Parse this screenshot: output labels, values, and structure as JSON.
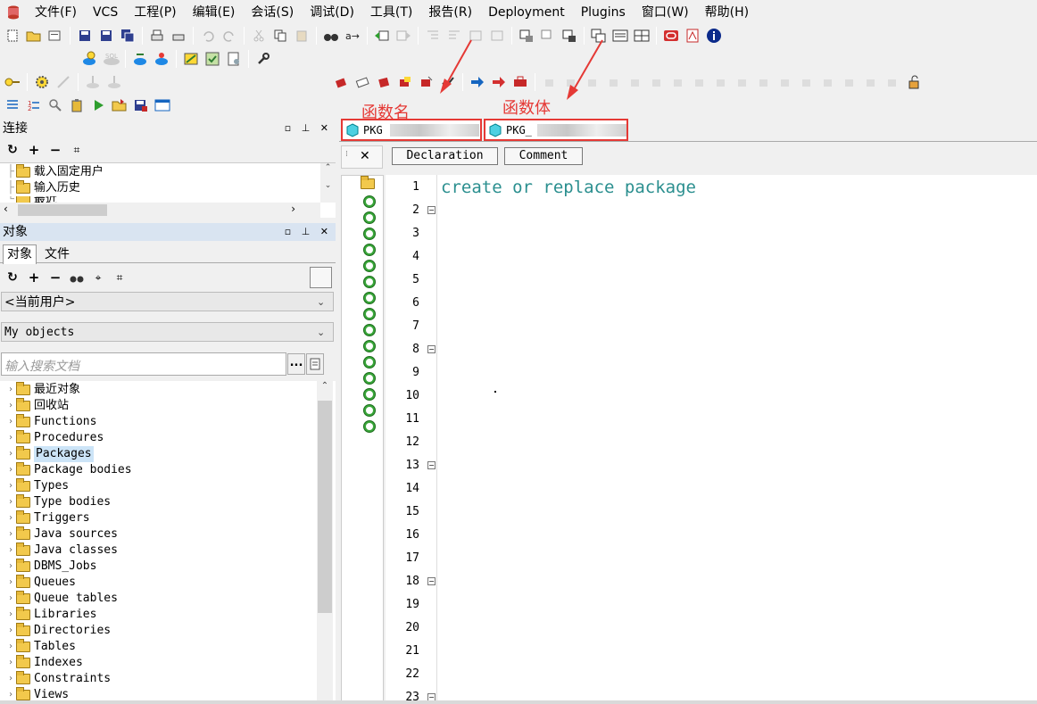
{
  "menu": [
    "文件(F)",
    "VCS",
    "工程(P)",
    "编辑(E)",
    "会话(S)",
    "调试(D)",
    "工具(T)",
    "报告(R)",
    "Deployment",
    "Plugins",
    "窗口(W)",
    "帮助(H)"
  ],
  "connection_panel": {
    "title": "连接",
    "tree": [
      "载入固定用户",
      "输入历史",
      "最近"
    ]
  },
  "objects_panel": {
    "title": "对象",
    "tabs": [
      "对象",
      "文件"
    ],
    "user_select": "<当前用户>",
    "filter_select": "My objects",
    "search_placeholder": "输入搜索文档",
    "more_button": "...",
    "tree": [
      "最近对象",
      "回收站",
      "Functions",
      "Procedures",
      "Packages",
      "Package bodies",
      "Types",
      "Type bodies",
      "Triggers",
      "Java sources",
      "Java classes",
      "DBMS_Jobs",
      "Queues",
      "Queue tables",
      "Libraries",
      "Directories",
      "Tables",
      "Indexes",
      "Constraints",
      "Views"
    ],
    "selected": "Packages"
  },
  "annotations": {
    "left": "函数名",
    "right": "函数体",
    "color": "#e53935"
  },
  "editor_tabs": [
    "PKG",
    "PKG_"
  ],
  "editor": {
    "close_glyph": "✕",
    "buttons": [
      "Declaration",
      "Comment"
    ],
    "code_line": "create or replace package",
    "code_color": "#2b8f8f",
    "line_numbers": [
      "1",
      "2",
      "3",
      "4",
      "5",
      "6",
      "7",
      "8",
      "9",
      "10",
      "11",
      "12",
      "13",
      "14",
      "15",
      "16",
      "17",
      "18",
      "19",
      "20",
      "21",
      "22",
      "23"
    ]
  }
}
